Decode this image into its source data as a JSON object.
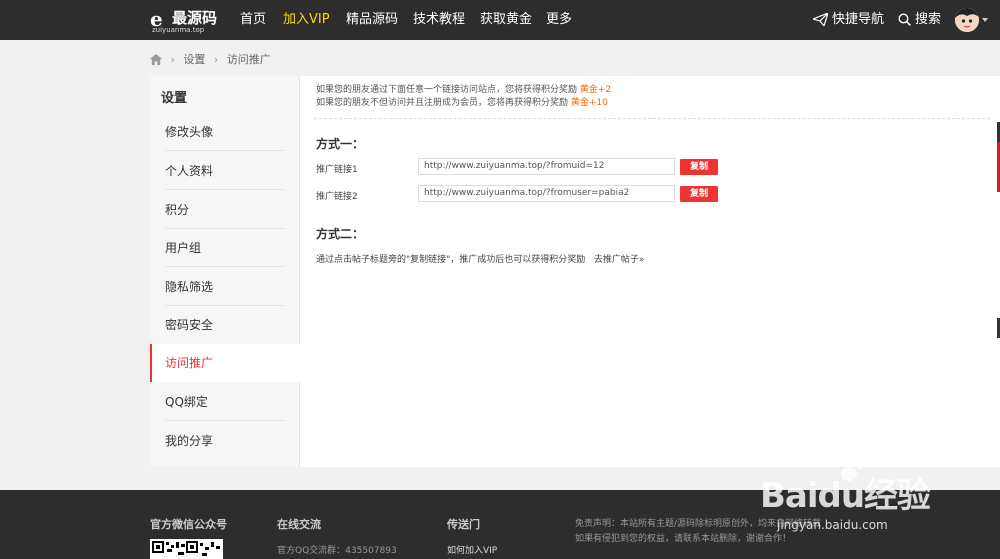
{
  "logo": {
    "mark": "e",
    "name": "最源码",
    "url": "zuiyuanma.top"
  },
  "nav": {
    "items": [
      {
        "label": "首页"
      },
      {
        "label": "加入VIP"
      },
      {
        "label": "精品源码"
      },
      {
        "label": "技术教程"
      },
      {
        "label": "获取黄金"
      },
      {
        "label": "更多"
      }
    ],
    "quick_nav": "快捷导航",
    "search": "搜索"
  },
  "breadcrumb": {
    "items": [
      "设置",
      "访问推广"
    ]
  },
  "sidebar": {
    "title": "设置",
    "items": [
      {
        "label": "修改头像"
      },
      {
        "label": "个人资料"
      },
      {
        "label": "积分"
      },
      {
        "label": "用户组"
      },
      {
        "label": "隐私筛选"
      },
      {
        "label": "密码安全"
      },
      {
        "label": "访问推广"
      },
      {
        "label": "QQ绑定"
      },
      {
        "label": "我的分享"
      }
    ]
  },
  "main": {
    "notice1": "如果您的朋友通过下面任意一个链接访问站点，您将获得积分奖励",
    "notice1_reward": "黄金+2",
    "notice2": "如果您的朋友不但访问并且注册成为会员，您将再获得积分奖励",
    "notice2_reward": "黄金+10",
    "method1_title": "方式一：",
    "link1_label": "推广链接1",
    "link1_value": "http://www.zuiyuanma.top/?fromuid=12",
    "link2_label": "推广链接2",
    "link2_value": "http://www.zuiyuanma.top/?fromuser=pabia2",
    "copy_label": "复制",
    "method2_title": "方式二：",
    "method2_desc": "通过点击帖子标题旁的\"复制链接\"，推广成功后也可以获得积分奖励",
    "method2_link": "去推广帖子»"
  },
  "footer": {
    "wechat_title": "官方微信公众号",
    "chat_title": "在线交流",
    "qq_group": "官方QQ交流群：435507893",
    "portal_title": "传送门",
    "portal_link": "如何加入VIP",
    "disclaimer1": "免责声明：本站所有主题/源码除标明原创外，均来自网络转载",
    "disclaimer2": "如果有侵犯到您的权益，请联系本站删除，谢谢合作！"
  },
  "watermark": {
    "text": "Baidu经验",
    "url": "jingyan.baidu.com"
  },
  "colors": {
    "nav_bg": "#2d2d2d",
    "accent_red": "#e33333",
    "vip_yellow": "#ffd800",
    "reward_orange": "#ff6600"
  }
}
